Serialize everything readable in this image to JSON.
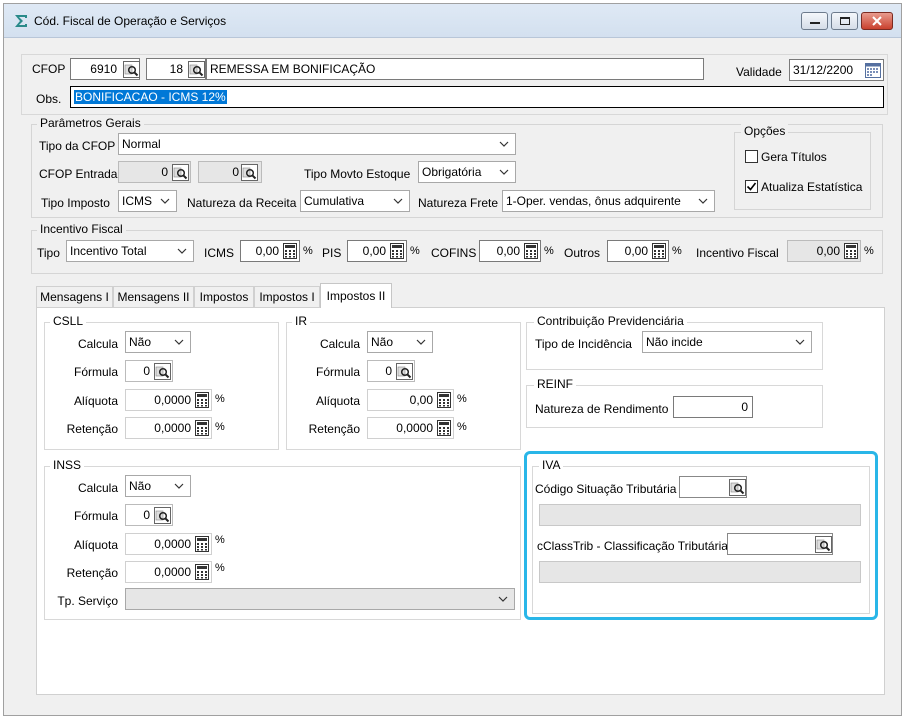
{
  "window": {
    "title": "Cód. Fiscal de Operação e Serviços"
  },
  "header": {
    "cfop_label": "CFOP",
    "cfop_value": "6910",
    "cfop_seq": "18",
    "cfop_desc": "REMESSA EM BONIFICAÇÃO",
    "validade_label": "Validade",
    "validade_value": "31/12/2200",
    "obs_label": "Obs.",
    "obs_value": "BONIFICACAO - ICMS 12%"
  },
  "parametros": {
    "title": "Parâmetros Gerais",
    "tipo_cfop_label": "Tipo da CFOP",
    "tipo_cfop_value": "Normal",
    "cfop_entrada_label": "CFOP Entrada",
    "cfop_entrada_1": "0",
    "cfop_entrada_2": "0",
    "tipo_movto_label": "Tipo Movto Estoque",
    "tipo_movto_value": "Obrigatória",
    "tipo_imposto_label": "Tipo Imposto",
    "tipo_imposto_value": "ICMS",
    "natureza_receita_label": "Natureza da Receita",
    "natureza_receita_value": "Cumulativa",
    "natureza_frete_label": "Natureza Frete",
    "natureza_frete_value": "1-Oper. vendas, ônus adquirente"
  },
  "opcoes": {
    "title": "Opções",
    "gera_titulos_label": "Gera Títulos",
    "gera_titulos_checked": false,
    "atualiza_label": "Atualiza Estatística",
    "atualiza_checked": true
  },
  "incentivo": {
    "title": "Incentivo Fiscal",
    "tipo_label": "Tipo",
    "tipo_value": "Incentivo Total",
    "icms_label": "ICMS",
    "icms_value": "0,00",
    "pis_label": "PIS",
    "pis_value": "0,00",
    "cofins_label": "COFINS",
    "cofins_value": "0,00",
    "outros_label": "Outros",
    "outros_value": "0,00",
    "incentivo_fiscal_label": "Incentivo Fiscal",
    "incentivo_fiscal_value": "0,00",
    "pct": "%"
  },
  "tabs": [
    "Mensagens I",
    "Mensagens II",
    "Impostos",
    "Impostos I",
    "Impostos II"
  ],
  "active_tab": "Impostos II",
  "csll": {
    "title": "CSLL",
    "calcula_label": "Calcula",
    "calcula_value": "Não",
    "formula_label": "Fórmula",
    "formula_value": "0",
    "aliquota_label": "Alíquota",
    "aliquota_value": "0,0000",
    "retencao_label": "Retenção",
    "retencao_value": "0,0000"
  },
  "ir": {
    "title": "IR",
    "calcula_label": "Calcula",
    "calcula_value": "Não",
    "formula_label": "Fórmula",
    "formula_value": "0",
    "aliquota_label": "Alíquota",
    "aliquota_value": "0,00",
    "retencao_label": "Retenção",
    "retencao_value": "0,0000"
  },
  "inss": {
    "title": "INSS",
    "calcula_label": "Calcula",
    "calcula_value": "Não",
    "formula_label": "Fórmula",
    "formula_value": "0",
    "aliquota_label": "Alíquota",
    "aliquota_value": "0,0000",
    "retencao_label": "Retenção",
    "retencao_value": "0,0000",
    "tp_servico_label": "Tp. Serviço",
    "tp_servico_value": ""
  },
  "contribuicao": {
    "title": "Contribuição Previdenciária",
    "tipo_label": "Tipo de Incidência",
    "tipo_value": "Não incide"
  },
  "reinf": {
    "title": "REINF",
    "natureza_label": "Natureza de Rendimento",
    "natureza_value": "0"
  },
  "iva": {
    "title": "IVA",
    "cst_label": "Código Situação Tributária",
    "cst_value": "",
    "cclass_label": "cClassTrib - Classificação Tributária",
    "cclass_value": "",
    "highlight_color": "#29b6e8"
  }
}
